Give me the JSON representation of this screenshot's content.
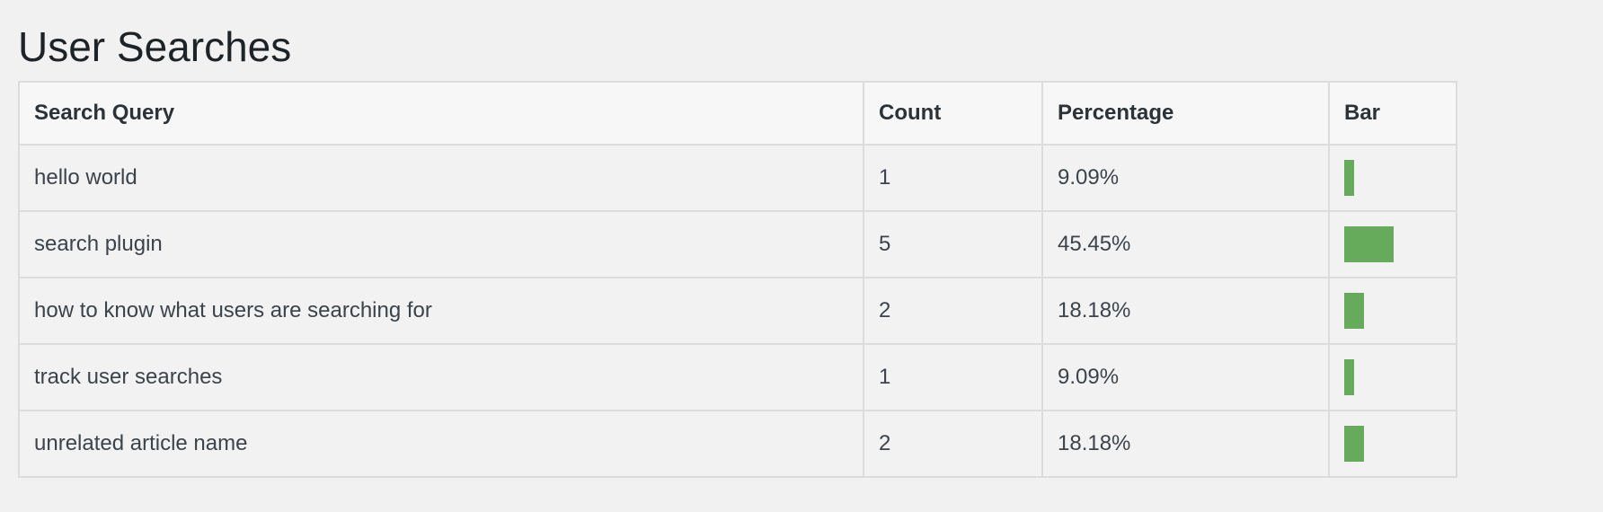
{
  "page": {
    "title": "User Searches"
  },
  "table": {
    "headers": [
      "Search Query",
      "Count",
      "Percentage",
      "Bar"
    ],
    "rows": [
      {
        "query": "hello world",
        "count": "1",
        "percentage": "9.09%",
        "bar_fraction": 0.0909
      },
      {
        "query": "search plugin",
        "count": "5",
        "percentage": "45.45%",
        "bar_fraction": 0.4545
      },
      {
        "query": "how to know what users are searching for",
        "count": "2",
        "percentage": "18.18%",
        "bar_fraction": 0.1818
      },
      {
        "query": "track user searches",
        "count": "1",
        "percentage": "9.09%",
        "bar_fraction": 0.0909
      },
      {
        "query": "unrelated article name",
        "count": "2",
        "percentage": "18.18%",
        "bar_fraction": 0.1818
      }
    ]
  },
  "colors": {
    "bar": "#66aa5c"
  }
}
